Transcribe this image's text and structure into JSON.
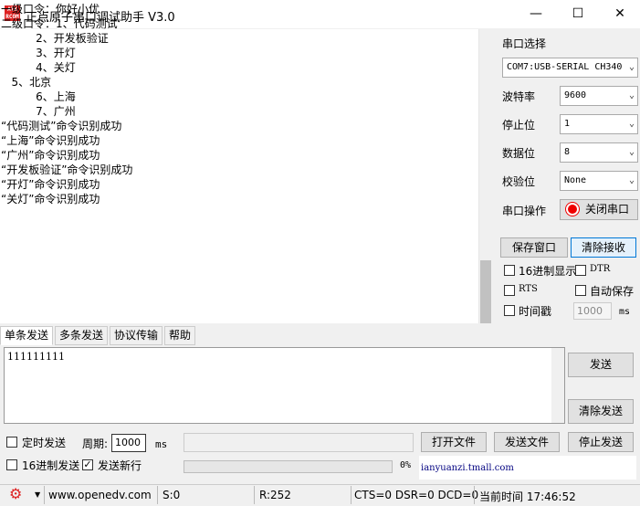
{
  "window": {
    "logo_text": "ATK\nRCOM",
    "title": "正点原子串口调试助手 V3.0",
    "minimize": "—",
    "maximize": "☐",
    "close": "✕"
  },
  "receive": {
    "lines": "一级口令：你好小优\n二级口令：1、代码测试\n          2、开发板验证\n          3、开灯\n          4、关灯\n   5、北京\n          6、上海\n          7、广州\n“代码测试”命令识别成功\n“上海”命令识别成功\n“广州”命令识别成功\n“开发板验证”命令识别成功\n“开灯”命令识别成功\n“关灯”命令识别成功"
  },
  "settings": {
    "port_label": "串口选择",
    "port_value": "COM7:USB-SERIAL CH340",
    "baud_label": "波特率",
    "baud_value": "9600",
    "stop_label": "停止位",
    "stop_value": "1",
    "data_label": "数据位",
    "data_value": "8",
    "parity_label": "校验位",
    "parity_value": "None",
    "op_label": "串口操作",
    "close_port_label": "关闭串口",
    "chevron": "⌄"
  },
  "recv_controls": {
    "save_window": "保存窗口",
    "clear_recv": "清除接收",
    "hex_display": "16进制显示",
    "dtr": "DTR",
    "rts": "RTS",
    "auto_save": "自动保存",
    "timestamp": "时间戳",
    "timestamp_period": "1000",
    "ms": "ms"
  },
  "tabs": [
    "单条发送",
    "多条发送",
    "协议传输",
    "帮助"
  ],
  "send": {
    "text": "111111111",
    "send_btn": "发送",
    "clear_send_btn": "清除发送",
    "timed_send": "定时发送",
    "period_label": "周期:",
    "period_value": "1000",
    "ms": "ms",
    "open_file": "打开文件",
    "send_file": "发送文件",
    "stop_send": "停止发送",
    "hex_send": "16进制发送",
    "send_newline": "发送新行",
    "progress_pct": "0%",
    "ad_text": "ianyuanzi.tmall.com"
  },
  "status": {
    "site": "www.openedv.com",
    "s_count": "S:0",
    "r_count": "R:252",
    "lines": "CTS=0 DSR=0 DCD=0",
    "time": "当前时间 17:46:52"
  }
}
